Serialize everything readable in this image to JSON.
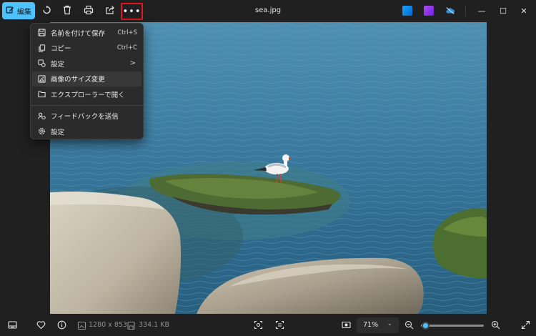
{
  "window": {
    "title": "sea.jpg",
    "minimize_glyph": "—",
    "maximize_glyph": "☐",
    "close_glyph": "✕"
  },
  "toolbar": {
    "edit_label": "編集",
    "more_glyph": "•••",
    "icons": [
      "edit-icon",
      "rotate-icon",
      "delete-icon",
      "print-icon",
      "share-icon",
      "more-icon"
    ],
    "accent_color": "#4cc2ff",
    "highlight_color": "#e0181c"
  },
  "menu": {
    "items": [
      {
        "icon": "save-as-icon",
        "label": "名前を付けて保存",
        "shortcut": "Ctrl+S"
      },
      {
        "icon": "copy-icon",
        "label": "コピー",
        "shortcut": "Ctrl+C"
      },
      {
        "icon": "set-as-icon",
        "label": "設定",
        "chevron": ">"
      },
      {
        "icon": "resize-icon",
        "label": "画像のサイズ変更"
      },
      {
        "icon": "folder-icon",
        "label": "エクスプローラーで開く"
      },
      {
        "icon": "feedback-icon",
        "label": "フィードバックを送信"
      },
      {
        "icon": "gear-icon",
        "label": "設定"
      }
    ]
  },
  "statusbar": {
    "dimensions": "1280 x 853",
    "filesize": "334.1 KB",
    "zoom": "71%",
    "zoom_chevron": "⌄",
    "zoom_fraction": 0.07
  }
}
